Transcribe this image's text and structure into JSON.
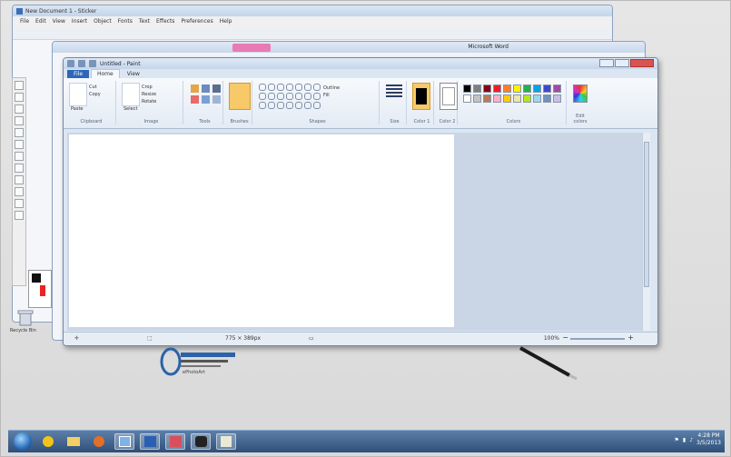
{
  "back_window": {
    "title": "New Document 1 - Sticker",
    "menu": [
      "File",
      "Edit",
      "View",
      "Insert",
      "Object",
      "Fonts",
      "Text",
      "Effects",
      "Preferences",
      "Help"
    ]
  },
  "middle_window": {
    "title": "Microsoft Word"
  },
  "paint_window": {
    "title": "Untitled - Paint",
    "file_tab": "File",
    "tabs": [
      "Home",
      "View"
    ],
    "groups": {
      "clipboard": "Clipboard",
      "image": "Image",
      "tools": "Tools",
      "brushes": "Brushes",
      "shapes": "Shapes",
      "size": "Size",
      "color1": "Color 1",
      "color2": "Color 2",
      "colors": "Colors",
      "edit_colors": "Edit colors"
    },
    "buttons": {
      "paste": "Paste",
      "cut": "Cut",
      "copy": "Copy",
      "select": "Select",
      "crop": "Crop",
      "resize": "Resize",
      "rotate": "Rotate",
      "outline": "Outline",
      "fill": "Fill"
    },
    "palette": [
      "#000000",
      "#7f7f7f",
      "#880015",
      "#ed1c24",
      "#ff7f27",
      "#fff200",
      "#22b14c",
      "#00a2e8",
      "#3f48cc",
      "#a349a4",
      "#ffffff",
      "#c3c3c3",
      "#b97a57",
      "#ffaec9",
      "#ffc90e",
      "#efe4b0",
      "#b5e61d",
      "#99d9ea",
      "#7092be",
      "#c8bfe7"
    ],
    "status": {
      "size": "775 × 389px",
      "zoom": "100%"
    }
  },
  "desktop": {
    "recycle_label": "Recycle Bin",
    "logo_text": "ePhotoArt"
  },
  "taskbar": {
    "clock_time": "4:28 PM",
    "clock_date": "3/5/2013"
  }
}
